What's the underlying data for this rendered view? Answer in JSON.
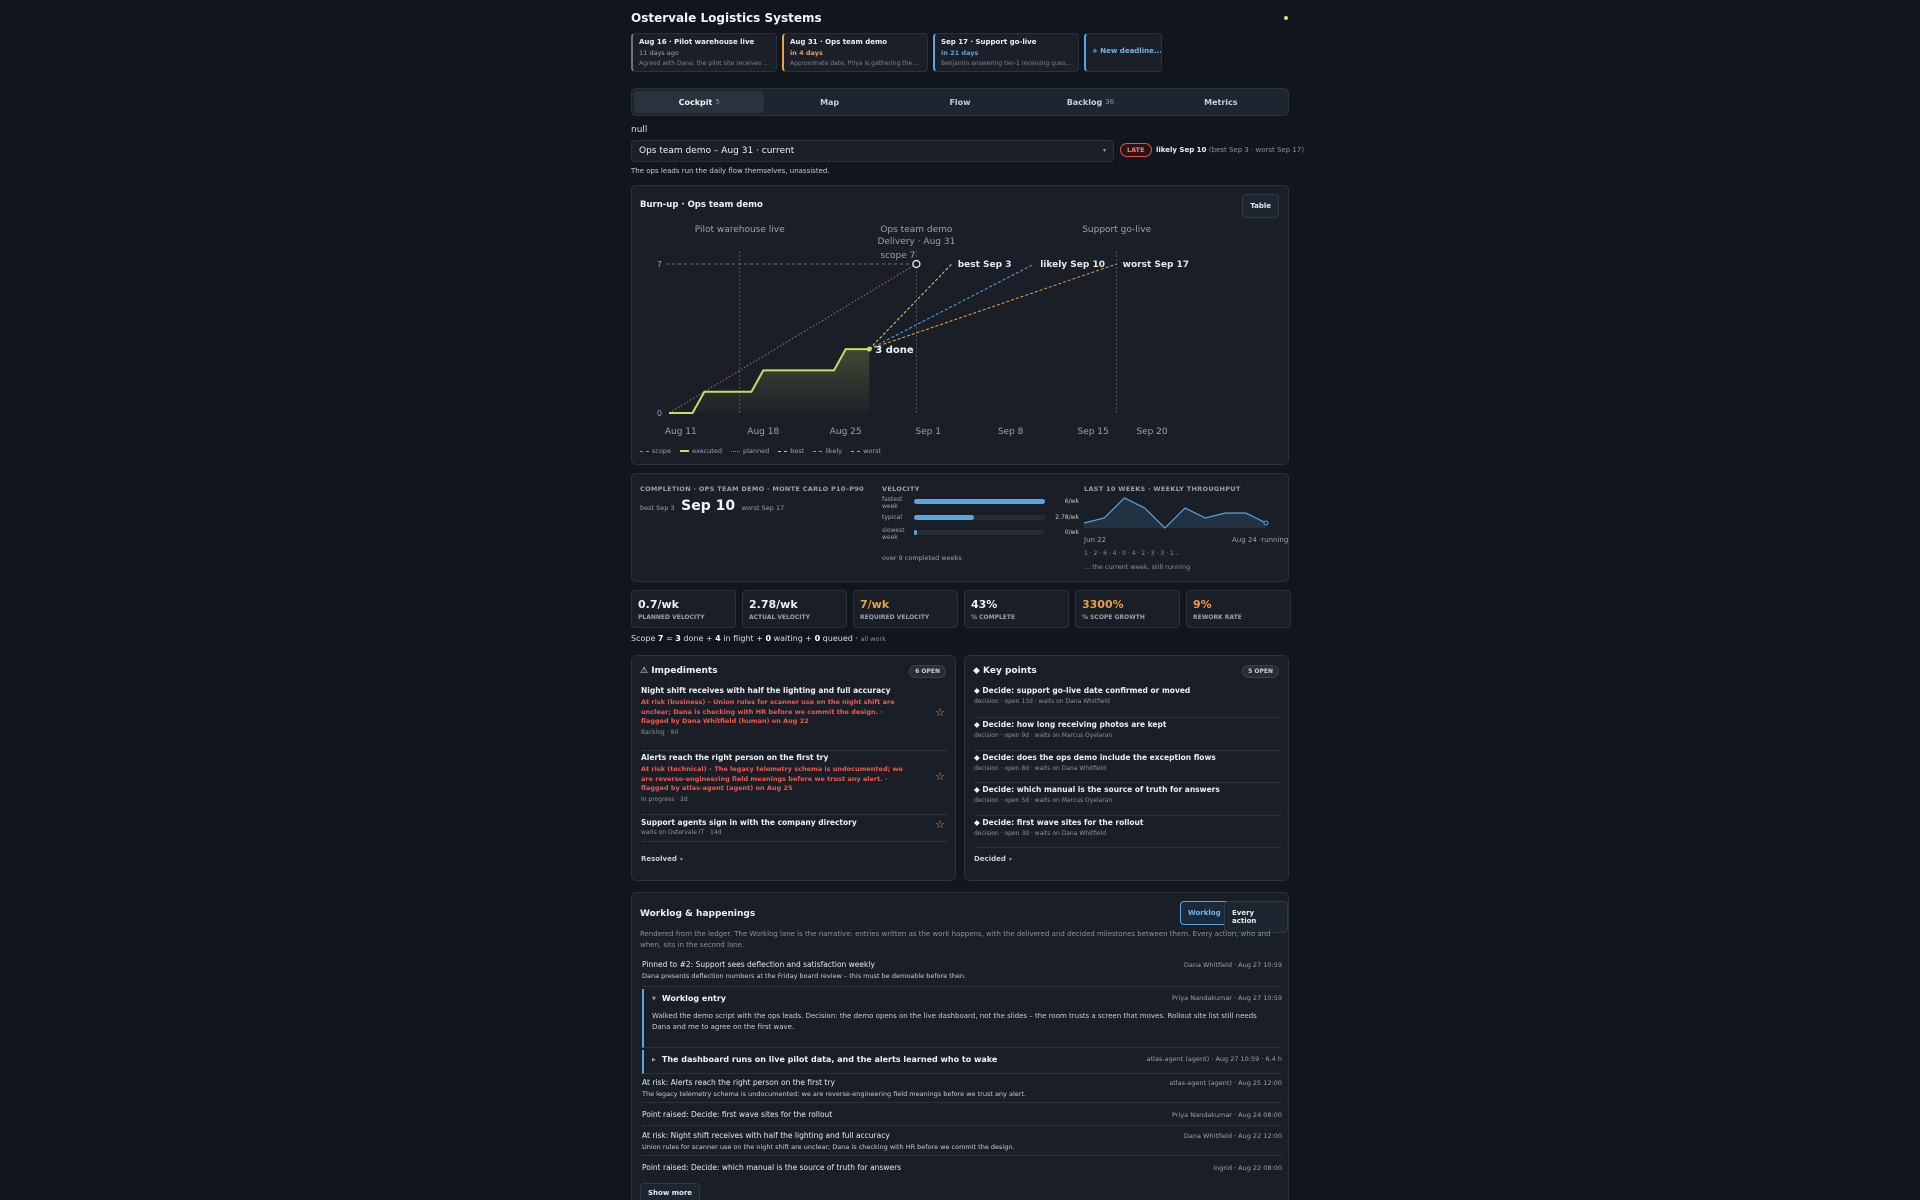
{
  "app": {
    "title": "Ostervale Logistics Systems"
  },
  "deadlines": [
    {
      "title": "Aug 16 · Pilot warehouse live",
      "status": "11 days ago",
      "status_color": "#9aa2ad",
      "desc": "Agreed with Dana: the pilot site receives ...",
      "accent": "#6f7680"
    },
    {
      "title": "Aug 31 · Ops team demo",
      "status": "in 4 days",
      "status_color": "#e8a04b",
      "desc": "Approximate date; Priya is gathering the ...",
      "accent": "#e8a04b"
    },
    {
      "title": "Sep 17 · Support go-live",
      "status": "in 21 days",
      "status_color": "#5aa6e0",
      "desc": "Benjamin answering tier-1 receiving ques...",
      "accent": "#5aa6e0"
    }
  ],
  "new_deadline_label": "+ New deadline...",
  "tabs": [
    {
      "label": "Cockpit",
      "count": "5",
      "active": true
    },
    {
      "label": "Map",
      "count": ""
    },
    {
      "label": "Flow",
      "count": ""
    },
    {
      "label": "Backlog",
      "count": "36"
    },
    {
      "label": "Metrics",
      "count": ""
    }
  ],
  "null_text": "null",
  "milestone_select": {
    "value": "Ops team demo – Aug 31 · current"
  },
  "status": {
    "badge": "LATE",
    "likely": "likely Sep 10",
    "range": "(best Sep 3 · worst Sep 17)"
  },
  "milestone_desc": "The ops leads run the daily flow themselves, unassisted.",
  "burnup": {
    "title": "Burn-up · Ops team demo",
    "table_button": "Table",
    "milestones": [
      "Pilot warehouse live",
      "Ops team demo",
      "Delivery · Aug 31",
      "Support go-live"
    ],
    "scope_label": "scope 7",
    "done_label": "3 done",
    "forecast_labels": {
      "best": "best Sep 3",
      "likely": "likely Sep 10",
      "worst": "worst Sep 17"
    },
    "legend": [
      "scope",
      "executed",
      "planned",
      "best",
      "likely",
      "worst"
    ]
  },
  "chart_data": {
    "type": "line",
    "title": "Burn-up · Ops team demo",
    "x_tick_labels": [
      "Aug 11",
      "Aug 18",
      "Aug 25",
      "Sep 1",
      "Sep 8",
      "Sep 15",
      "Sep 20"
    ],
    "y_tick_labels": [
      "0",
      "7"
    ],
    "ylim": [
      0,
      7
    ],
    "scope": 7,
    "executed": [
      {
        "x": "Aug 10",
        "y": 0
      },
      {
        "x": "Aug 12",
        "y": 0
      },
      {
        "x": "Aug 13",
        "y": 1
      },
      {
        "x": "Aug 17",
        "y": 1
      },
      {
        "x": "Aug 18",
        "y": 2
      },
      {
        "x": "Aug 24",
        "y": 2
      },
      {
        "x": "Aug 25",
        "y": 3
      },
      {
        "x": "Aug 27",
        "y": 3
      }
    ],
    "planned": [
      {
        "x": "Aug 10",
        "y": 0
      },
      {
        "x": "Aug 31",
        "y": 7
      }
    ],
    "best": [
      {
        "x": "Aug 27",
        "y": 3
      },
      {
        "x": "Sep 3",
        "y": 7
      }
    ],
    "likely": [
      {
        "x": "Aug 27",
        "y": 3
      },
      {
        "x": "Sep 10",
        "y": 7
      }
    ],
    "worst": [
      {
        "x": "Aug 27",
        "y": 3
      },
      {
        "x": "Sep 17",
        "y": 7
      }
    ],
    "markers": [
      {
        "name": "Pilot warehouse live",
        "x": "Aug 16"
      },
      {
        "name": "Ops team demo",
        "x": "Aug 31"
      },
      {
        "name": "Support go-live",
        "x": "Sep 17"
      }
    ],
    "colors": {
      "executed": "#c9dd5e",
      "planned": "#b06a6a",
      "best": "#c9dd5e",
      "likely": "#5aa6e0",
      "worst": "#e8a04b",
      "scope": "#8a929e"
    }
  },
  "completion": {
    "label": "COMPLETION · OPS TEAM DEMO · MONTE CARLO P10–P90",
    "best": "best Sep 3",
    "likely": "Sep 10",
    "worst": "worst Sep 17"
  },
  "velocity": {
    "label": "VELOCITY",
    "rows": [
      {
        "name": "fastest week",
        "value": "6/wk",
        "fill": 1.0
      },
      {
        "name": "typical",
        "value": "2.78/wk",
        "fill": 0.46
      },
      {
        "name": "slowest week",
        "value": "0/wk",
        "fill": 0.02
      }
    ],
    "footer": "over 9 completed weeks"
  },
  "throughput": {
    "label": "LAST 10 WEEKS · WEEKLY THROUGHPUT",
    "values": [
      1,
      2,
      6,
      4,
      0,
      4,
      2,
      3,
      3,
      1
    ],
    "start": "Jun 22",
    "end": "Aug 24 ·running",
    "series_text": "1 · 2 · 6 · 4 · 0 · 4 · 2 · 3 · 3 · 1...",
    "note": "... the current week, still running"
  },
  "kpis": [
    {
      "value": "0.7/wk",
      "label": "PLANNED VELOCITY",
      "color": "#eef1f5"
    },
    {
      "value": "2.78/wk",
      "label": "ACTUAL VELOCITY",
      "color": "#eef1f5"
    },
    {
      "value": "7/wk",
      "label": "REQUIRED VELOCITY",
      "color": "#e8a04b"
    },
    {
      "value": "43%",
      "label": "% COMPLETE",
      "color": "#eef1f5"
    },
    {
      "value": "3300%",
      "label": "% SCOPE GROWTH",
      "color": "#e8a04b"
    },
    {
      "value": "9%",
      "label": "REWORK RATE",
      "color": "#e8a04b"
    }
  ],
  "scope_summary": {
    "scope": "7",
    "done": "3",
    "in_flight": "4",
    "waiting": "0",
    "queued": "0",
    "note": "all work"
  },
  "impediments": {
    "title": "⚠ Impediments",
    "badge": "6 OPEN",
    "items": [
      {
        "title": "Night shift receives with half the lighting and full accuracy",
        "risk": "At risk (business) – Union rules for scanner use on the night shift are unclear; Dana is checking with HR before we commit the design. · flagged by Dana Whitfield (human) on Aug 22",
        "meta": "Backlog · 9d"
      },
      {
        "title": "Alerts reach the right person on the first try",
        "risk": "At risk (technical) – The legacy telemetry schema is undocumented; we are reverse-engineering field meanings before we trust any alert. · flagged by atlas-agent (agent) on Aug 25",
        "meta": "In progress · 2d"
      },
      {
        "title": "Support agents sign in with the company directory",
        "risk": "",
        "meta": "waits on Ostervale IT · 14d"
      }
    ],
    "footer": "Resolved",
    "footer_caret": "▾"
  },
  "keypoints": {
    "title": "◆ Key points",
    "badge": "5 OPEN",
    "items": [
      {
        "title": "◆ Decide: support go-live date confirmed or moved",
        "meta": "decision · open 13d · waits on Dana Whitfield"
      },
      {
        "title": "◆ Decide: how long receiving photos are kept",
        "meta": "decision · open 9d · waits on Marcus Oyelaran"
      },
      {
        "title": "◆ Decide: does the ops demo include the exception flows",
        "meta": "decision · open 8d · waits on Dana Whitfield"
      },
      {
        "title": "◆ Decide: which manual is the source of truth for answers",
        "meta": "decision · open 5d · waits on Marcus Oyelaran"
      },
      {
        "title": "◆ Decide: first wave sites for the rollout",
        "meta": "decision · open 3d · waits on Dana Whitfield"
      }
    ],
    "footer": "Decided",
    "footer_caret": "▾"
  },
  "worklog": {
    "title": "Worklog & happenings",
    "toggle": [
      "Worklog",
      "Every action"
    ],
    "intro": "Rendered from the ledger. The Worklog lane is the narrative: entries written as the work happens, with the delivered and decided milestones between them. Every action, who and when, sits in the second lane.",
    "entries": [
      {
        "kind": "row",
        "title": "Pinned to #2: Support sees deflection and satisfaction weekly",
        "sub": "Dana presents deflection numbers at the Friday board review – this must be demoable before then.",
        "who": "Dana Whitfield · Aug 27 10:59"
      },
      {
        "kind": "block",
        "title": "Worklog entry",
        "body": "Walked the demo script with the ops leads. Decision: the demo opens on the live dashboard, not the slides – the room trusts a screen that moves. Rollout site list still needs Dana and me to agree on the first wave.",
        "who": "Priya Nandakumar · Aug 27 10:59"
      },
      {
        "kind": "block",
        "title": "The dashboard runs on live pilot data, and the alerts learned who to wake",
        "body": "",
        "who": "atlas-agent (agent) · Aug 27 10:59 · 6.4 h"
      },
      {
        "kind": "row",
        "title": "At risk: Alerts reach the right person on the first try",
        "sub": "The legacy telemetry schema is undocumented; we are reverse-engineering field meanings before we trust any alert.",
        "who": "atlas-agent (agent) · Aug 25 12:00"
      },
      {
        "kind": "row",
        "title": "Point raised: Decide: first wave sites for the rollout",
        "sub": "",
        "who": "Priya Nandakumar · Aug 24 08:00"
      },
      {
        "kind": "row",
        "title": "At risk: Night shift receives with half the lighting and full accuracy",
        "sub": "Union rules for scanner use on the night shift are unclear; Dana is checking with HR before we commit the design.",
        "who": "Dana Whitfield · Aug 22 12:00"
      },
      {
        "kind": "row",
        "title": "Point raised: Decide: which manual is the source of truth for answers",
        "sub": "",
        "who": "Ingrid · Aug 22 08:00"
      }
    ],
    "show_more": "Show more"
  }
}
